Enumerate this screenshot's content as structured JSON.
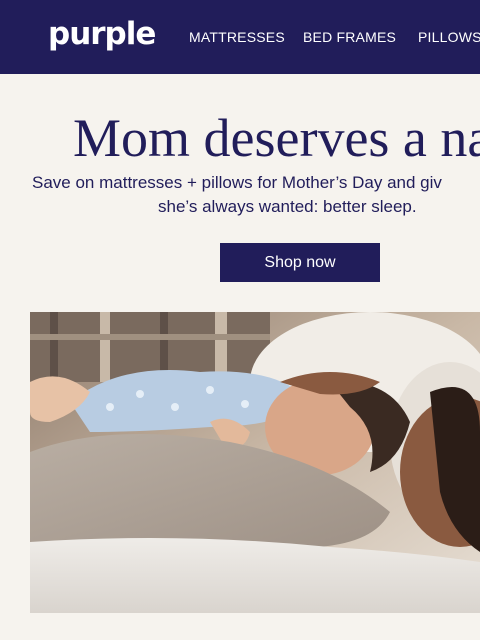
{
  "header": {
    "logo_text": "purple",
    "nav": [
      "MATTRESSES",
      "BED FRAMES",
      "PILLOWS"
    ]
  },
  "promo": {
    "headline": "Mom deserves a na",
    "subtext_line1": "Save on mattresses + pillows for Mother’s Day and giv",
    "subtext_line2": "she’s always wanted: better sleep.",
    "cta_label": "Shop now"
  },
  "hero_image": {
    "description_icon": "mother-and-baby-photo"
  },
  "colors": {
    "brand": "#211d5a",
    "page_background": "#f6f3ee",
    "button_text": "#ffffff"
  }
}
